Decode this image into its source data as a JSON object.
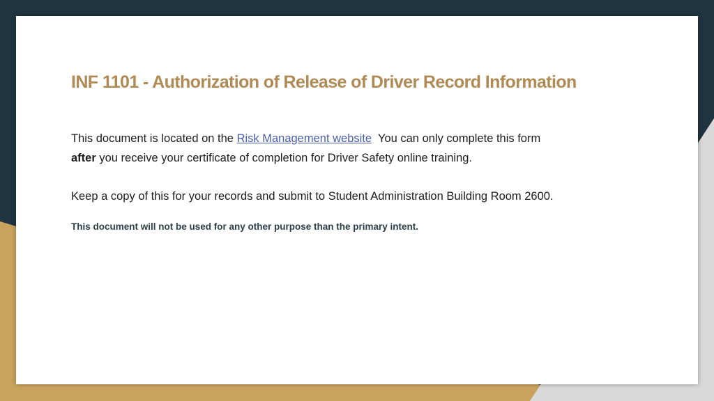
{
  "slide": {
    "title": "INF 1101 - Authorization of Release of Driver Record Information",
    "paragraph1": {
      "intro": "This document is located on the ",
      "link_text": "Risk Management website",
      "after_link": "  You can only complete this form ",
      "bold_word": "after",
      "rest": " you receive your certificate of completion for Driver Safety online training."
    },
    "paragraph2": "Keep a copy of this for your records and submit to Student Administration Building Room 2600.",
    "note": "This document will not be used for any other purpose than the primary intent."
  },
  "colors": {
    "background_dark": "#1f3440",
    "accent_gold": "#c9a35e",
    "accent_gray": "#d9d9d9",
    "title_color": "#b08a54",
    "link_color": "#4a5fa8",
    "note_color": "#2b3f4a"
  }
}
